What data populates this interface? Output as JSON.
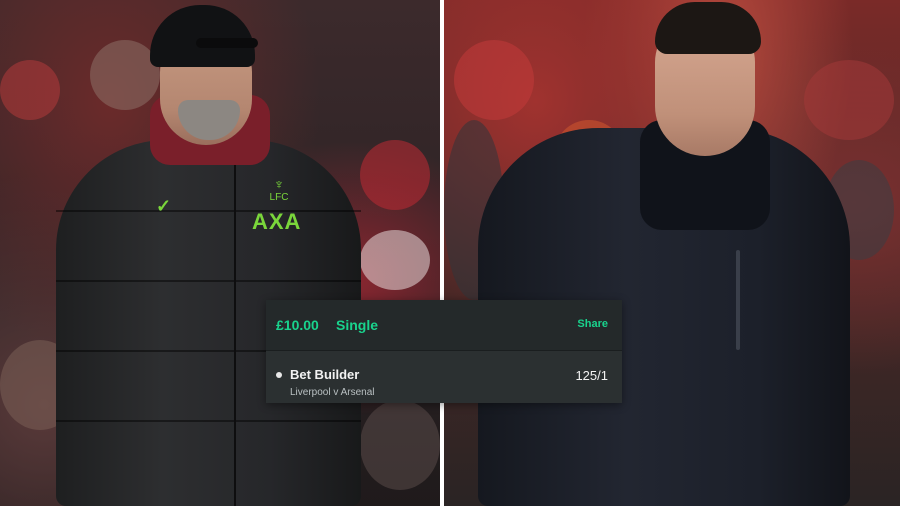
{
  "betslip": {
    "stake": "£10.00",
    "bet_type": "Single",
    "share_label": "Share",
    "selection": "Bet Builder",
    "event": "Liverpool v Arsenal",
    "odds": "125/1"
  },
  "left_photo": {
    "sponsor_text": "AXA",
    "crest_text": "LFC"
  },
  "colors": {
    "accent": "#19d38d",
    "slip_background": "#282c2e",
    "kit_green": "#7ad63b"
  }
}
